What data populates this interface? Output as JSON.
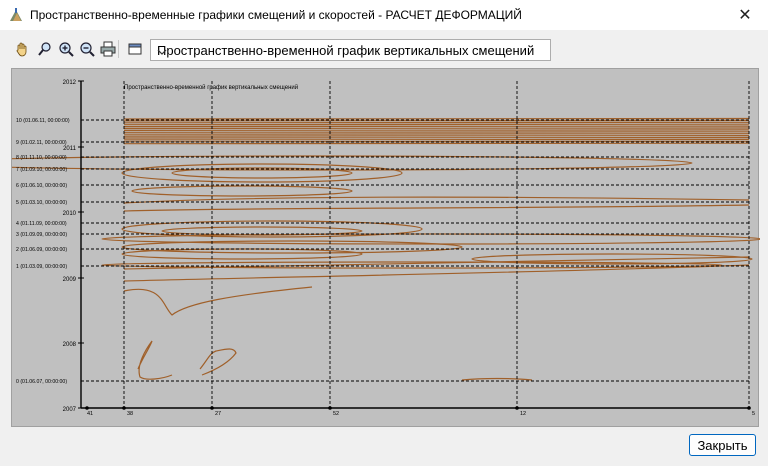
{
  "window": {
    "title": "Пространственно-временные графики смещений и скоростей - РАСЧЕТ ДЕФОРМАЦИЙ",
    "close_glyph": "✕"
  },
  "toolbar": {
    "icons": [
      "hand-pan-icon",
      "zoom-region-icon",
      "zoom-in-icon",
      "zoom-out-icon",
      "print-icon",
      "window-icon"
    ],
    "graph_select": {
      "selected": "Пространственно-временной график вертикальных смещений",
      "arrow": "⌄"
    }
  },
  "chart_data": {
    "type": "contour",
    "title": "Пространственно-временной график вертикальных смещений",
    "y_year_ticks": [
      "2012",
      "2011",
      "2010",
      "2009",
      "2008",
      "2007"
    ],
    "cycles": [
      {
        "label": "10 (01.06.11, 00:00:00)"
      },
      {
        "label": "9 (01.02.11, 00:00:00)"
      },
      {
        "label": "8 (01.11.10, 00:00:00)"
      },
      {
        "label": "7 (01.09.10, 00:00:00)"
      },
      {
        "label": "6 (01.06.10, 00:00:00)"
      },
      {
        "label": "5 (01.03.10, 00:00:00)"
      },
      {
        "label": "4 (01.11.09, 00:00:00)"
      },
      {
        "label": "3 (01.09.09, 00:00:00)"
      },
      {
        "label": "2 (01.06.09, 00:00:00)"
      },
      {
        "label": "1 (01.03.09, 00:00:00)"
      },
      {
        "label": "0 (01.06.07, 00:00:00)"
      }
    ],
    "x_points": [
      "41",
      "38",
      "27",
      "52",
      "12",
      "5"
    ],
    "colors": {
      "background": "#c0c0c0",
      "contour": "#a0602a",
      "grid": "#000000"
    }
  },
  "footer": {
    "close_button_label": "Закрыть"
  }
}
